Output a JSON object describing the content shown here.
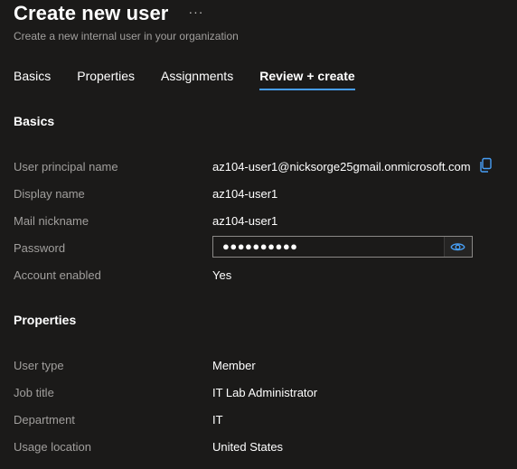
{
  "header": {
    "title": "Create new user",
    "more_label": "···",
    "subtitle": "Create a new internal user in your organization"
  },
  "tabs": [
    {
      "label": "Basics",
      "active": false
    },
    {
      "label": "Properties",
      "active": false
    },
    {
      "label": "Assignments",
      "active": false
    },
    {
      "label": "Review + create",
      "active": true
    }
  ],
  "basics": {
    "heading": "Basics",
    "fields": [
      {
        "label": "User principal name",
        "value": "az104-user1@nicksorge25gmail.onmicrosoft.com"
      },
      {
        "label": "Display name",
        "value": "az104-user1"
      },
      {
        "label": "Mail nickname",
        "value": "az104-user1"
      },
      {
        "label": "Password",
        "value": "●●●●●●●●●●"
      },
      {
        "label": "Account enabled",
        "value": "Yes"
      }
    ]
  },
  "properties": {
    "heading": "Properties",
    "fields": [
      {
        "label": "User type",
        "value": "Member"
      },
      {
        "label": "Job title",
        "value": "IT Lab Administrator"
      },
      {
        "label": "Department",
        "value": "IT"
      },
      {
        "label": "Usage location",
        "value": "United States"
      }
    ]
  },
  "icons": {
    "copy": "copy-icon",
    "reveal": "eye-icon",
    "more": "more-icon"
  },
  "colors": {
    "background": "#1b1a19",
    "accent": "#479ef5",
    "label": "#a19f9d",
    "text": "#ffffff",
    "input_border": "#8a8886"
  }
}
